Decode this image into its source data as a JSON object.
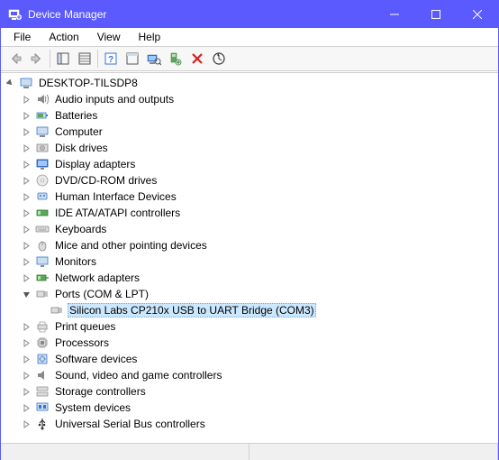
{
  "window": {
    "title": "Device Manager"
  },
  "menus": {
    "file": "File",
    "action": "Action",
    "view": "View",
    "help": "Help"
  },
  "tree": {
    "root": "DESKTOP-TILSDP8",
    "items": [
      "Audio inputs and outputs",
      "Batteries",
      "Computer",
      "Disk drives",
      "Display adapters",
      "DVD/CD-ROM drives",
      "Human Interface Devices",
      "IDE ATA/ATAPI controllers",
      "Keyboards",
      "Mice and other pointing devices",
      "Monitors",
      "Network adapters",
      "Ports (COM & LPT)",
      "Print queues",
      "Processors",
      "Software devices",
      "Sound, video and game controllers",
      "Storage controllers",
      "System devices",
      "Universal Serial Bus controllers"
    ],
    "ports_child": "Silicon Labs CP210x USB to UART Bridge (COM3)"
  }
}
